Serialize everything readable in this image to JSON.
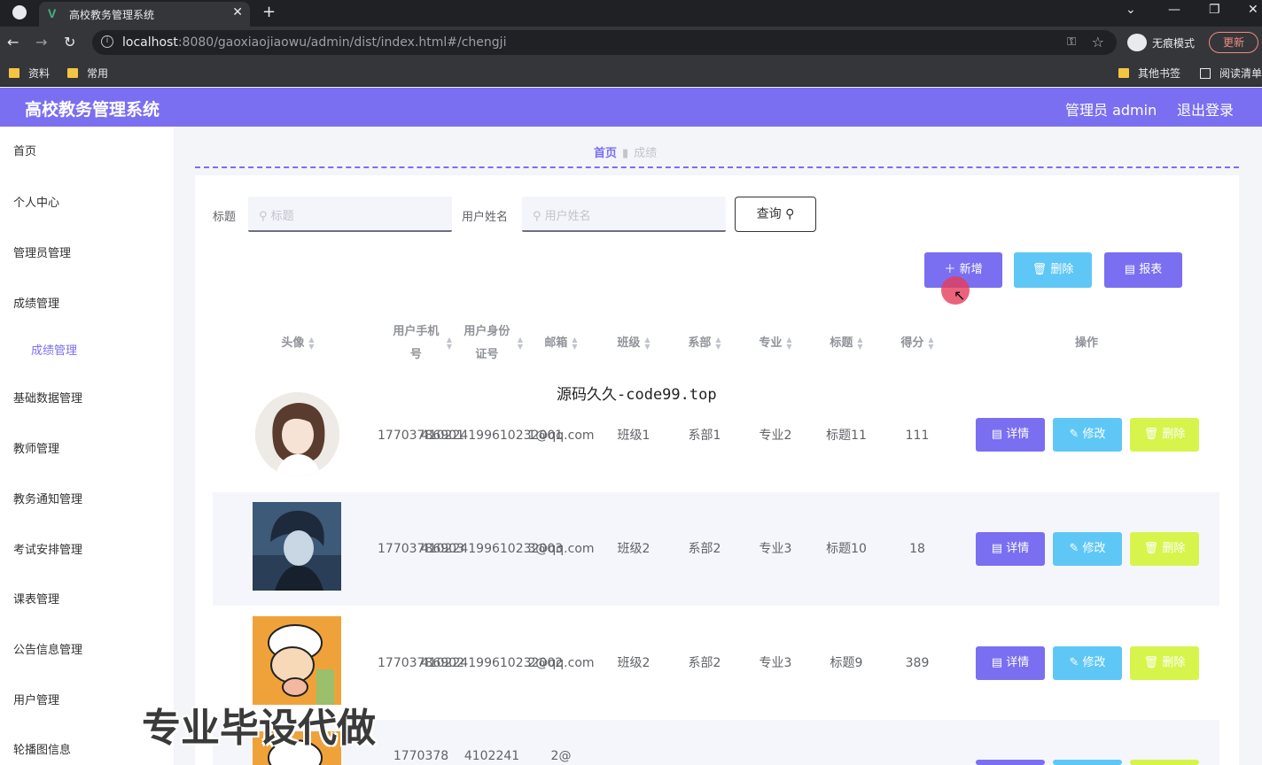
{
  "browser": {
    "tab_title": "高校教务管理系统",
    "url_host": "localhost",
    "url_rest": ":8080/gaoxiaojiaowu/admin/dist/index.html#/chengji",
    "incognito_label": "无痕模式",
    "update_label": "更新",
    "bookmarks": [
      "资料",
      "常用",
      "其他书签",
      "阅读清单"
    ]
  },
  "header": {
    "app_title": "高校教务管理系统",
    "admin_label": "管理员 admin",
    "logout_label": "退出登录"
  },
  "sidebar": {
    "items": [
      "首页",
      "个人中心",
      "管理员管理",
      "成绩管理",
      "成绩管理",
      "基础数据管理",
      "教师管理",
      "教务通知管理",
      "考试安排管理",
      "课表管理",
      "公告信息管理",
      "用户管理",
      "轮播图信息"
    ]
  },
  "breadcrumb": {
    "home": "首页",
    "current": "成绩"
  },
  "search": {
    "title_label": "标题",
    "title_placeholder": "标题",
    "name_label": "用户姓名",
    "name_placeholder": "用户姓名",
    "query_label": "查询"
  },
  "actions": {
    "add": "新增",
    "delete": "删除",
    "report": "报表"
  },
  "table": {
    "headers": [
      "头像",
      "用户手机号",
      "用户身份证号",
      "邮箱",
      "班级",
      "系部",
      "专业",
      "标题",
      "得分",
      "操作"
    ],
    "rows": [
      {
        "phone": "17703786901",
        "idcard": "410224199610232001",
        "email": "1@qq.com",
        "class": "班级1",
        "dept": "系部1",
        "major": "专业2",
        "title": "标题11",
        "score": "111"
      },
      {
        "phone": "17703786903",
        "idcard": "410224199610232003",
        "email": "3@qq.com",
        "class": "班级2",
        "dept": "系部2",
        "major": "专业3",
        "title": "标题10",
        "score": "18"
      },
      {
        "phone": "17703786902",
        "idcard": "410224199610232002",
        "email": "2@qq.com",
        "class": "班级2",
        "dept": "系部2",
        "major": "专业3",
        "title": "标题9",
        "score": "389"
      },
      {
        "phone": "1770378",
        "idcard": "4102241",
        "email": "2@",
        "class": "",
        "dept": "",
        "major": "",
        "title": "",
        "score": ""
      }
    ],
    "row_buttons": {
      "detail": "详情",
      "edit": "修改",
      "delete": "删除"
    }
  },
  "overlays": {
    "watermark_code": "源码久久-code99.top",
    "promo": "专业毕设代做"
  },
  "colors": {
    "primary": "#7a6ff0",
    "info": "#5fc7f5",
    "warning": "#d7f44c"
  }
}
